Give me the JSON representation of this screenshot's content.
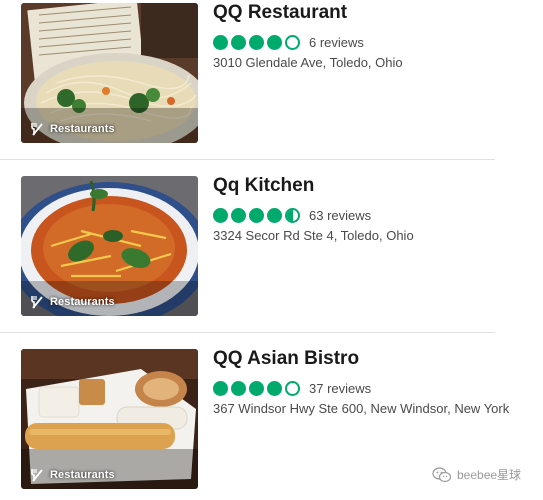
{
  "accent_color": "#00aa6c",
  "listings": [
    {
      "name": "QQ Restaurant",
      "category": "Restaurants",
      "category_icon": "fork-knife-icon",
      "rating": 4,
      "rating_max": 5,
      "reviews": "6 reviews",
      "address": "3010 Glendale Ave, Toledo, Ohio"
    },
    {
      "name": "Qq Kitchen",
      "category": "Restaurants",
      "category_icon": "fork-knife-icon",
      "rating": 4.5,
      "rating_max": 5,
      "reviews": "63 reviews",
      "address": "3324 Secor Rd Ste 4, Toledo, Ohio"
    },
    {
      "name": "QQ Asian Bistro",
      "category": "Restaurants",
      "category_icon": "fork-knife-icon",
      "rating": 4,
      "rating_max": 5,
      "reviews": "37 reviews",
      "address": "367 Windsor Hwy Ste 600, New Windsor, New York"
    }
  ],
  "watermark": {
    "icon": "wechat-icon",
    "text": "beebee星球"
  }
}
